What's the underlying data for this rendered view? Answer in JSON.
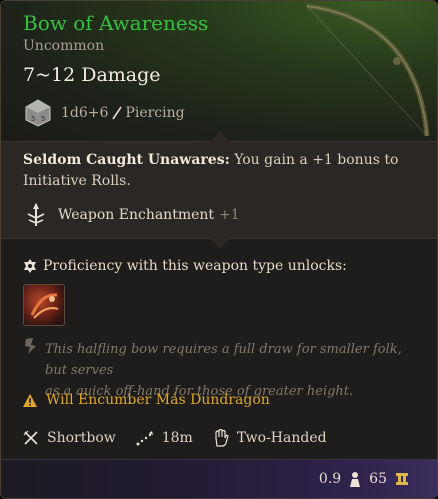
{
  "item": {
    "name": "Bow of Awareness",
    "rarity": "Uncommon",
    "damage": "7~12 Damage",
    "damage_dice": "1d6+6",
    "damage_type": "Piercing"
  },
  "enchantment": {
    "title": "Seldom Caught Unawares:",
    "line1": " You gain a +1 bonus to",
    "line2": "Initiative Rolls.",
    "passive_label": "Weapon Enchantment",
    "passive_bonus": "+1"
  },
  "proficiency": {
    "text": "Proficiency with this weapon type unlocks:"
  },
  "flavor": {
    "line1": "This halfling bow requires a full draw for smaller folk, but serves",
    "line2": "as a quick off-hand for those of greater height."
  },
  "warning": "Will Encumber Más Dundragon",
  "properties": {
    "type": "Shortbow",
    "range": "18m",
    "handedness": "Two-Handed"
  },
  "footer": {
    "weight": "0.9",
    "value": "65"
  },
  "colors": {
    "rarity_green": "#33c23d",
    "warning_orange": "#e0a62a",
    "footer_purple": "#3a2c5c"
  },
  "icons": [
    "die-icon",
    "piercing-icon",
    "enchant-icon",
    "proficiency-icon",
    "unlock-skill-icon",
    "flavor-icon",
    "warning-icon",
    "shortbow-icon",
    "range-icon",
    "two-handed-icon",
    "weight-icon",
    "gold-icon"
  ]
}
